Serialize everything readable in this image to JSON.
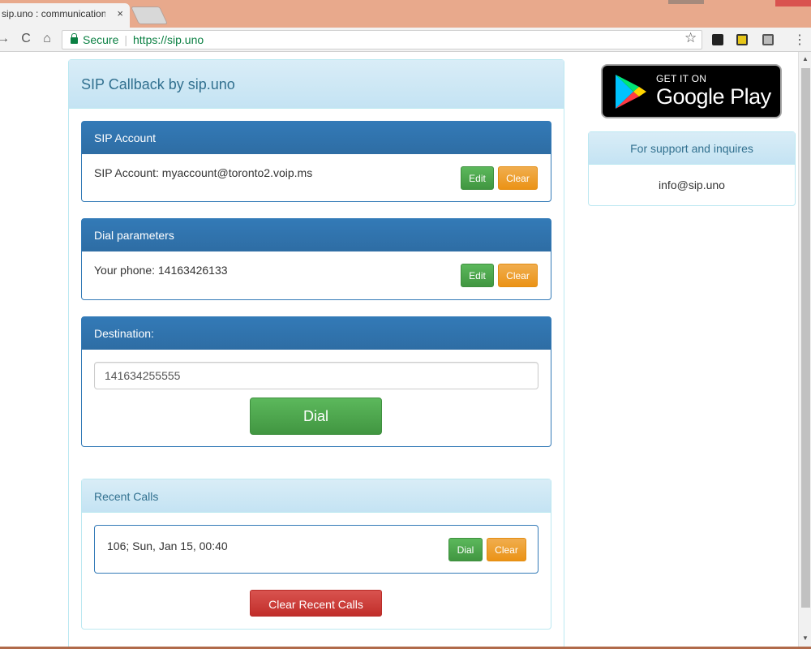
{
  "browser": {
    "tab_title": "sip.uno : communication",
    "tab_close": "×",
    "secure_label": "Secure",
    "url": "https://sip.uno"
  },
  "page": {
    "title": "SIP Callback by sip.uno",
    "sip_account": {
      "heading": "SIP Account",
      "text": "SIP Account: myaccount@toronto2.voip.ms",
      "edit_label": "Edit",
      "clear_label": "Clear"
    },
    "dial_params": {
      "heading": "Dial parameters",
      "text": "Your phone: 14163426133",
      "edit_label": "Edit",
      "clear_label": "Clear"
    },
    "destination": {
      "heading": "Destination:",
      "value": "141634255555",
      "dial_label": "Dial"
    },
    "recent_calls": {
      "heading": "Recent Calls",
      "items": [
        {
          "text": "106; Sun, Jan 15, 00:40",
          "dial_label": "Dial",
          "clear_label": "Clear"
        }
      ],
      "clear_all_label": "Clear Recent Calls"
    }
  },
  "sidebar": {
    "google_play": {
      "small_text": "GET IT ON",
      "big_text": "Google Play"
    },
    "support": {
      "heading": "For support and inquires",
      "email": "info@sip.uno"
    }
  },
  "colors": {
    "primary": "#337ab7",
    "success": "#5cb85c",
    "warning": "#f0ad4e",
    "danger": "#d9534f",
    "info_text": "#31708f"
  },
  "icons": [
    "back-icon",
    "reload-icon",
    "home-icon",
    "lock-icon",
    "star-icon",
    "menu-icon",
    "google-play-icon"
  ]
}
